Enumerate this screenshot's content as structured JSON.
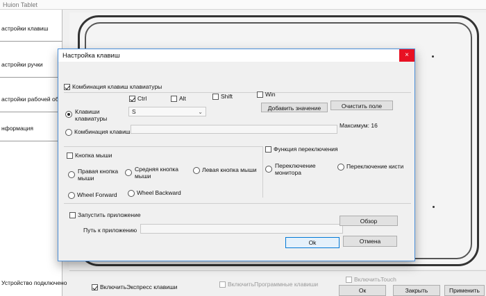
{
  "app": {
    "window_title": "Huion Tablet"
  },
  "sidebar": {
    "items": [
      {
        "label": "астройки клавиш"
      },
      {
        "label": "астройки ручки"
      },
      {
        "label": "астройки рабочей обла"
      },
      {
        "label": "нформация"
      }
    ],
    "status": "Устройство подключено"
  },
  "bottom_bar": {
    "express_keys_label": "ВключитьЭкспресс клавиши",
    "program_keys_label": "ВключитьПрограммные клавиши",
    "touch_label": "ВключитьTouch",
    "ok_label": "Ок",
    "close_label": "Закрыть",
    "apply_label": "Применить"
  },
  "dialog": {
    "title": "Настройка клавиш",
    "close_glyph": "×",
    "keyboard_group": {
      "label": "Комбинация клавиш клавиатуры",
      "checked": true,
      "modifiers": [
        {
          "label": "Ctrl",
          "checked": true
        },
        {
          "label": "Alt",
          "checked": false
        },
        {
          "label": "Shift",
          "checked": false
        },
        {
          "label": "Win",
          "checked": false
        }
      ],
      "keys_radio_label": "Клавиши клавиатуры",
      "keys_value": "S",
      "add_button": "Добавить значение",
      "clear_button": "Очистить поле",
      "combo_radio_label": "Комбинация клавиш",
      "max_label": "Максимум: 16"
    },
    "mouse_group": {
      "label": "Кнопка мыши",
      "checked": false,
      "right": "Правая кнопка мыши",
      "middle": "Средняя кнопка мыши",
      "left": "Левая кнопка мыши",
      "wheel_forward": "Wheel Forward",
      "wheel_backward": "Wheel Backward"
    },
    "switch_group": {
      "label": "Функция переключения",
      "checked": false,
      "monitor": "Переключение монитора",
      "brush": "Переключение кисти"
    },
    "app_group": {
      "label": "Запустить приложение",
      "checked": false,
      "path_label": "Путь к приложению",
      "browse_button": "Обзор"
    },
    "ok_button": "Ok",
    "cancel_button": "Отмена"
  }
}
